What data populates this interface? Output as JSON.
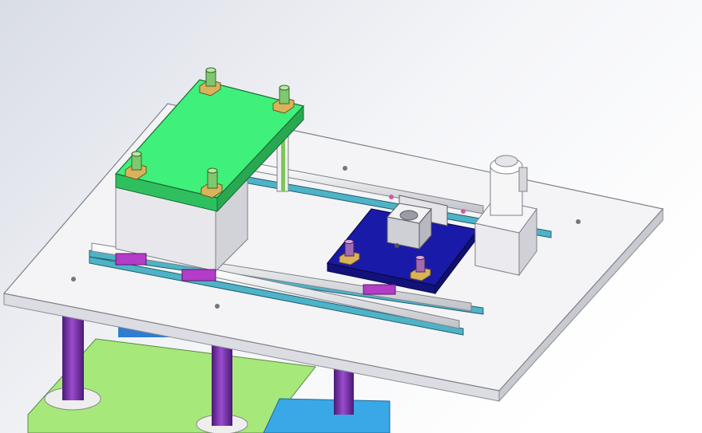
{
  "scene": {
    "colors": {
      "background_top": "#dfe3ea",
      "background_bottom": "#ffffff",
      "plate": "#f4f4f6",
      "plate_edge": "#c9cad0",
      "green_plate": "#3ff07a",
      "green_plate_side": "#2fbf5f",
      "blue_plate": "#1a1aa8",
      "lower_green": "#a6e87a",
      "lower_blue": "#3aa7e6",
      "column_purple": "#6a2c9a",
      "rail_teal": "#4fb3c8",
      "slider_magenta": "#b43cc8",
      "bushing_gold": "#d9b25a",
      "bolt_green": "#7fc870",
      "guide_white": "#f2f2f2",
      "motor_white": "#f6f6f6"
    },
    "icons": [
      "cad-3d-view"
    ]
  }
}
